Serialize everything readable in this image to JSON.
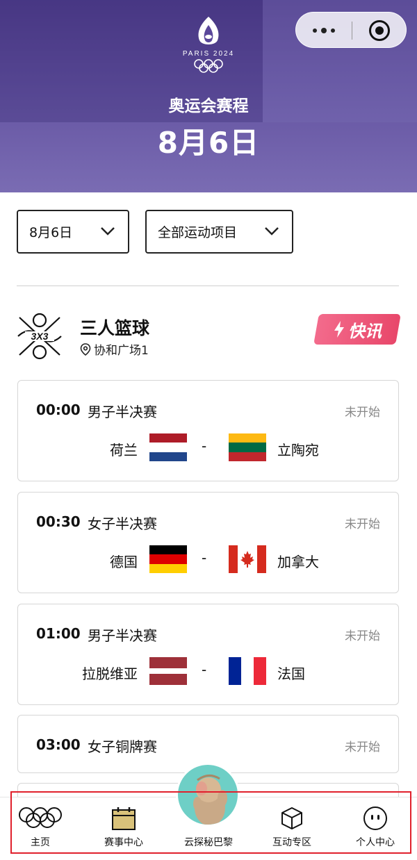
{
  "header": {
    "brand_text": "PARIS 2024",
    "title": "奥运会赛程",
    "date": "8月6日",
    "colors": {
      "top": "#4e3c8a",
      "bottom": "#7a6cb3"
    }
  },
  "filters": {
    "date_value": "8月6日",
    "sport_value": "全部运动项目"
  },
  "sport": {
    "name": "三人篮球",
    "venue": "协和广场1",
    "news_badge": "快讯",
    "icon": "3x3-basketball-icon"
  },
  "matches": [
    {
      "time": "00:00",
      "round": "男子半决赛",
      "status": "未开始",
      "team_a": "荷兰",
      "team_b": "立陶宛",
      "sep": "-"
    },
    {
      "time": "00:30",
      "round": "女子半决赛",
      "status": "未开始",
      "team_a": "德国",
      "team_b": "加拿大",
      "sep": "-"
    },
    {
      "time": "01:00",
      "round": "男子半决赛",
      "status": "未开始",
      "team_a": "拉脱维亚",
      "team_b": "法国",
      "sep": "-"
    },
    {
      "time": "03:00",
      "round": "女子铜牌赛",
      "status": "未开始"
    }
  ],
  "tabbar": {
    "items": [
      {
        "label": "主页",
        "icon": "olympic-rings-icon"
      },
      {
        "label": "赛事中心",
        "icon": "calendar-icon"
      },
      {
        "label": "云探秘巴黎",
        "icon": "mascot-icon"
      },
      {
        "label": "互动专区",
        "icon": "cube-icon"
      },
      {
        "label": "个人中心",
        "icon": "face-icon"
      }
    ]
  },
  "accent": {
    "badge": "#e8476a",
    "highlight": "#e0202c"
  }
}
